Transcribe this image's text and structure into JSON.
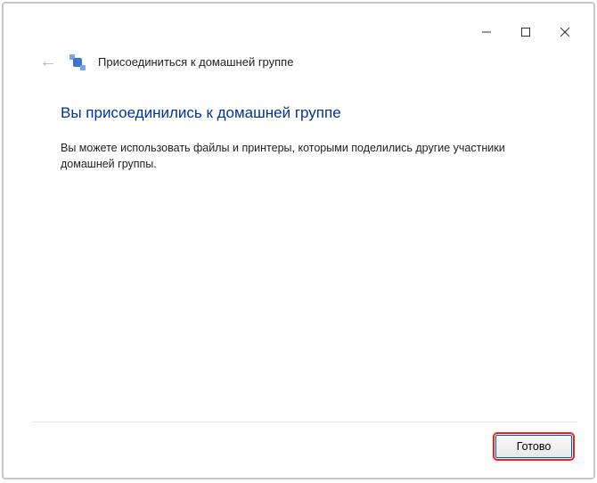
{
  "window": {
    "wizard_title": "Присоединиться к домашней группе"
  },
  "content": {
    "heading": "Вы присоединились к домашней группе",
    "body": "Вы можете использовать файлы и принтеры, которыми поделились другие участники домашней группы."
  },
  "footer": {
    "done_label": "Готово"
  }
}
